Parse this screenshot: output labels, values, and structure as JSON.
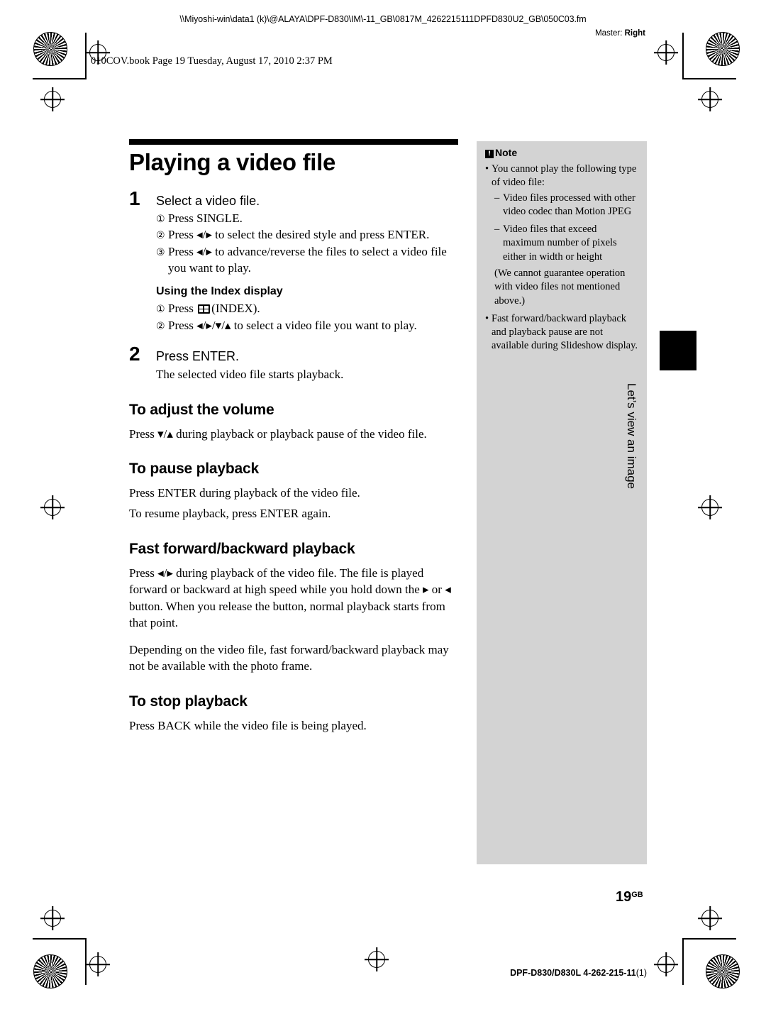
{
  "header": {
    "path": "\\\\Miyoshi-win\\data1 (k)\\@ALAYA\\DPF-D830\\IM\\-11_GB\\0817M_4262215111DPFD830U2_GB\\050C03.fm",
    "master_label": "Master:",
    "master_value": "Right",
    "book_line": "010COV.book  Page 19  Tuesday, August 17, 2010  2:37 PM"
  },
  "main": {
    "title": "Playing a video file",
    "step1": {
      "number": "1",
      "heading": "Select a video file.",
      "items": [
        {
          "marker": "①",
          "text": "Press SINGLE."
        },
        {
          "marker": "②",
          "text": "Press ◂/▸ to select the desired style and press ENTER."
        },
        {
          "marker": "③",
          "text": "Press ◂/▸ to advance/reverse the files to select a video file you want to play."
        }
      ]
    },
    "index_display": {
      "heading": "Using the Index display",
      "items": [
        {
          "marker": "①",
          "pre": "Press ",
          "post": "(INDEX)."
        },
        {
          "marker": "②",
          "text": "Press ◂/▸/▾/▴ to select a video file you want to play."
        }
      ]
    },
    "step2": {
      "number": "2",
      "heading": "Press ENTER.",
      "body": "The selected video file starts playback."
    },
    "sections": [
      {
        "heading": "To adjust the volume",
        "paragraphs": [
          "Press ▾/▴ during playback or playback pause of the video file."
        ]
      },
      {
        "heading": "To pause playback",
        "paragraphs": [
          "Press ENTER during playback of the video file.",
          "To resume playback, press ENTER again."
        ]
      },
      {
        "heading": "Fast forward/backward playback",
        "paragraphs": [
          "Press ◂/▸ during playback of the video file. The file is played forward or backward at high speed while you hold down the ▸ or ◂ button. When you release the button, normal playback starts from that point.",
          "Depending on the video file, fast forward/backward playback may not be available with the photo frame."
        ]
      },
      {
        "heading": "To stop playback",
        "paragraphs": [
          "Press BACK while the video file is being played."
        ]
      }
    ]
  },
  "note": {
    "heading": "Note",
    "items": [
      {
        "type": "bullet",
        "text": "You cannot play the following type of video file:"
      },
      {
        "type": "dash",
        "text": "Video files processed with other video codec than Motion JPEG"
      },
      {
        "type": "dash",
        "text": "Video files that exceed maximum number of pixels either in width or height"
      },
      {
        "type": "para",
        "text": "(We cannot guarantee operation with video files not mentioned above.)"
      },
      {
        "type": "bullet",
        "text": "Fast forward/backward playback and playback pause are not available during Slideshow display."
      }
    ]
  },
  "side_tab": {
    "label": "Let’s view an image"
  },
  "footer": {
    "page_number": "19",
    "page_suffix": "GB",
    "model_bold": "DPF-D830/D830L  4-262-215-11",
    "model_thin": "(1)"
  }
}
